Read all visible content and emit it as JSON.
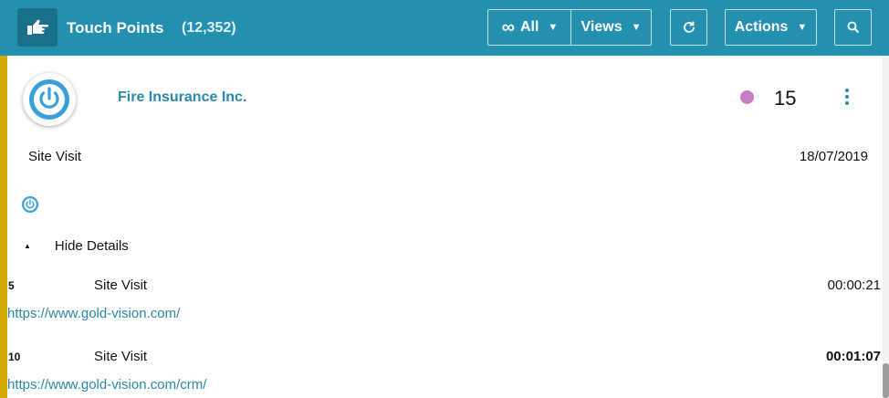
{
  "header": {
    "title": "Touch Points",
    "count": "(12,352)",
    "filter_label": "All",
    "views_label": "Views",
    "actions_label": "Actions"
  },
  "icons": {
    "logo": "thumb-pointing-hand-icon",
    "filter": "infinity-icon",
    "refresh": "refresh-icon",
    "search": "search-icon",
    "avatar": "power-icon",
    "more": "kebab-icon",
    "small": "power-icon"
  },
  "colors": {
    "header_bg": "#2390b0",
    "accent_bar": "#d0a800",
    "link": "#2a88a8",
    "status_dot": "#c47fc2"
  },
  "record": {
    "company": "Fire Insurance Inc.",
    "score": "15",
    "type": "Site Visit",
    "date": "18/07/2019",
    "details_toggle": "Hide Details"
  },
  "details": [
    {
      "num": "5",
      "type": "Site Visit",
      "time": "00:00:21",
      "url": "https://www.gold-vision.com/"
    },
    {
      "num": "10",
      "type": "Site Visit",
      "time": "00:01:07",
      "url": "https://www.gold-vision.com/crm/"
    }
  ]
}
